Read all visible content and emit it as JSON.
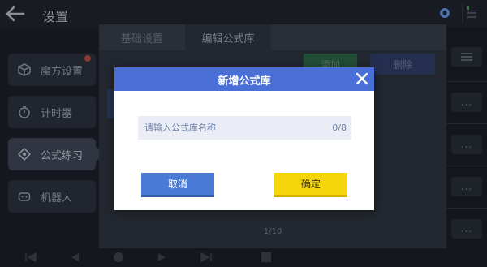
{
  "topbar": {
    "title": "设置",
    "status_text": ""
  },
  "sidebar": {
    "items": [
      {
        "label": "魔方设置",
        "icon": "cube-icon",
        "has_badge": true
      },
      {
        "label": "计时器",
        "icon": "timer-icon"
      },
      {
        "label": "公式练习",
        "icon": "formula-icon",
        "active": true
      },
      {
        "label": "机器人",
        "icon": "robot-icon"
      }
    ]
  },
  "main": {
    "tabs": [
      {
        "label": "基础设置"
      },
      {
        "label": "编辑公式库",
        "active": true
      }
    ],
    "add_label": "添加",
    "delete_label": "删除",
    "pager": "1/10"
  },
  "right_strip": {
    "more_label": "..."
  },
  "modal": {
    "title": "新增公式库",
    "input": {
      "placeholder": "请输入公式库名称",
      "value": "",
      "counter": "0/8"
    },
    "cancel_label": "取消",
    "confirm_label": "确定"
  },
  "colors": {
    "header_blue": "#4a70d8",
    "cancel_blue": "#4a7ad6",
    "confirm_yellow": "#f5d60c",
    "add_green": "#2c5f44",
    "delete_blue": "#2d3b63"
  }
}
